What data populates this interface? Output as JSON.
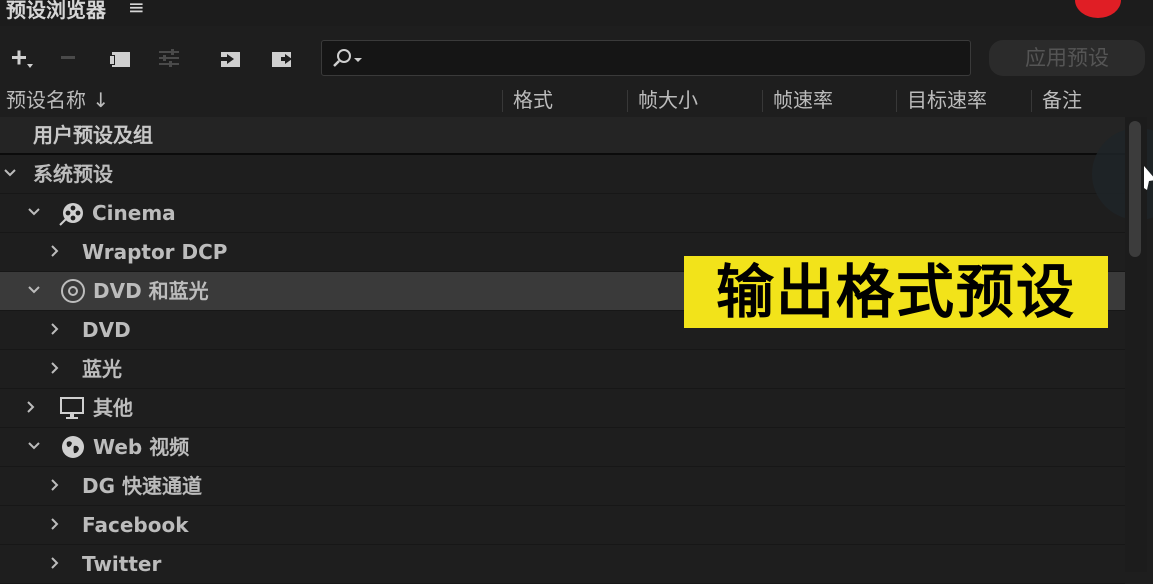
{
  "panel": {
    "title": "预设浏览器",
    "menu_glyph": "≡"
  },
  "toolbar": {
    "search_placeholder": "",
    "apply_label": "应用预设"
  },
  "columns": {
    "name": "预设名称 ↓",
    "format": "格式",
    "frame_size": "帧大小",
    "frame_rate": "帧速率",
    "target_rate": "目标速率",
    "notes": "备注"
  },
  "group": {
    "label": "用户预设及组"
  },
  "tree": [
    {
      "label": "系统预设",
      "level": 0,
      "expanded": true,
      "icon": ""
    },
    {
      "label": "Cinema",
      "level": 1,
      "expanded": true,
      "icon": "film-reel-icon"
    },
    {
      "label": "Wraptor DCP",
      "level": 2,
      "expanded": false,
      "icon": ""
    },
    {
      "label": "DVD 和蓝光",
      "level": 1,
      "expanded": true,
      "icon": "disc-icon",
      "selected": true
    },
    {
      "label": "DVD",
      "level": 2,
      "expanded": false,
      "icon": ""
    },
    {
      "label": "蓝光",
      "level": 2,
      "expanded": false,
      "icon": ""
    },
    {
      "label": "其他",
      "level": 1,
      "expanded": false,
      "icon": "monitor-icon"
    },
    {
      "label": "Web 视频",
      "level": 1,
      "expanded": true,
      "icon": "globe-icon"
    },
    {
      "label": "DG 快速通道",
      "level": 2,
      "expanded": false,
      "icon": ""
    },
    {
      "label": "Facebook",
      "level": 2,
      "expanded": false,
      "icon": ""
    },
    {
      "label": "Twitter",
      "level": 2,
      "expanded": false,
      "icon": ""
    }
  ],
  "overlay": {
    "text": "输出格式预设"
  }
}
